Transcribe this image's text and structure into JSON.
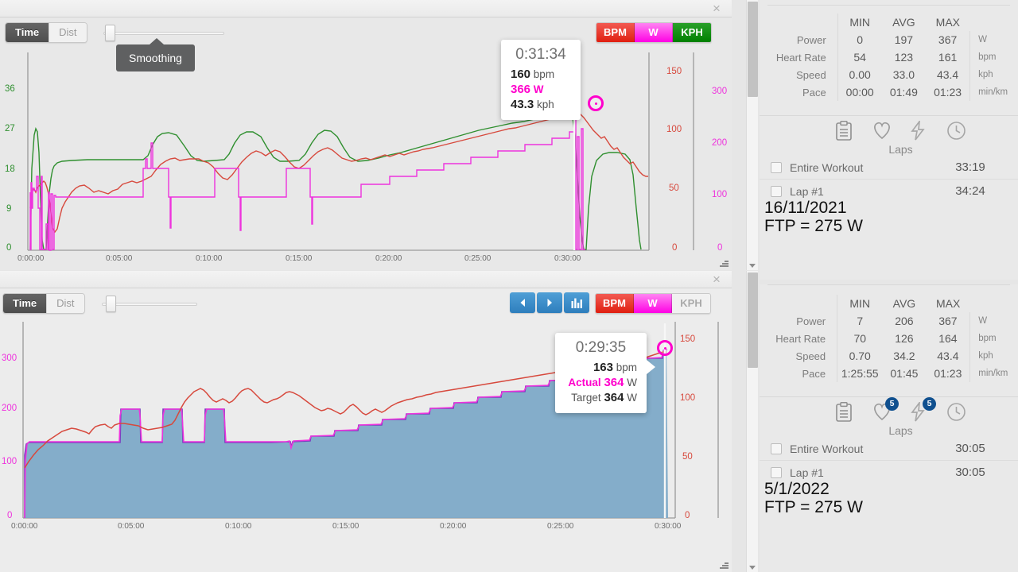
{
  "app": {
    "background": "#e6e6e6"
  },
  "colors": {
    "hr": "#d7493d",
    "power": "#ee33dd",
    "speed": "#2f8f2f",
    "target_fill": "#7ba7c7",
    "target_line": "#7b3fbf",
    "accent_blue": "#2e7ebd",
    "badge_blue": "#10508f",
    "marker": "#ff00cc"
  },
  "chart1": {
    "close_label": "×",
    "xaxis_toggle": {
      "options": [
        "Time",
        "Dist"
      ],
      "selected": "Time"
    },
    "smoothing": {
      "tooltip": "Smoothing",
      "value": 0
    },
    "metrics": [
      {
        "label": "BPM",
        "active": true
      },
      {
        "label": "W",
        "active": true
      },
      {
        "label": "KPH",
        "active": true
      }
    ],
    "tooltip": {
      "time": "0:31:34",
      "rows": [
        {
          "value": "160",
          "unit": "bpm",
          "color": "dark"
        },
        {
          "value": "366",
          "unit": "W",
          "color": "power"
        },
        {
          "value": "43.3",
          "unit": "kph",
          "color": "dark"
        }
      ]
    },
    "chart_data": {
      "type": "line",
      "title": "",
      "xlabel": "",
      "grid": false,
      "legend": "none",
      "x_ticks": [
        "0:00:00",
        "0:05:00",
        "0:10:00",
        "0:15:00",
        "0:20:00",
        "0:25:00",
        "0:30:00"
      ],
      "xlim": [
        0,
        2070
      ],
      "axes": [
        {
          "name": "Speed",
          "unit": "kph",
          "side": "left",
          "color": "#2f8f2f",
          "ticks": [
            0,
            9,
            18,
            27,
            36
          ],
          "ylim": [
            0,
            40
          ]
        },
        {
          "name": "Heart Rate",
          "unit": "bpm",
          "side": "right-inner",
          "color": "#d7493d",
          "ticks": [
            0,
            50,
            100,
            150
          ],
          "ylim": [
            0,
            170
          ]
        },
        {
          "name": "Power",
          "unit": "W",
          "side": "right-outer",
          "color": "#ee33dd",
          "ticks": [
            0,
            100,
            200,
            300
          ],
          "ylim": [
            0,
            380
          ]
        }
      ],
      "series": [
        {
          "name": "Speed",
          "unit": "kph",
          "color": "#2f8f2f",
          "axis": "Speed"
        },
        {
          "name": "Heart Rate",
          "unit": "bpm",
          "color": "#d7493d",
          "axis": "Heart Rate"
        },
        {
          "name": "Power",
          "unit": "W",
          "color": "#ee33dd",
          "axis": "Power"
        }
      ],
      "cursor": {
        "time": "0:31:34",
        "bpm": 160,
        "watts": 366,
        "kph": 43.3
      }
    }
  },
  "chart2": {
    "close_label": "×",
    "xaxis_toggle": {
      "options": [
        "Time",
        "Dist"
      ],
      "selected": "Time"
    },
    "smoothing": {
      "value": 0
    },
    "nav": [
      {
        "icon": "prev-icon"
      },
      {
        "icon": "next-icon"
      },
      {
        "icon": "bar-chart-icon"
      }
    ],
    "metrics": [
      {
        "label": "BPM",
        "active": true
      },
      {
        "label": "W",
        "active": true
      },
      {
        "label": "KPH",
        "active": false
      }
    ],
    "tooltip": {
      "time": "0:29:35",
      "rows": [
        {
          "label": "",
          "value": "163",
          "unit": "bpm"
        },
        {
          "label": "Actual",
          "value": "364",
          "unit": "W"
        },
        {
          "label": "Target",
          "value": "364",
          "unit": "W"
        }
      ]
    },
    "chart_data": {
      "type": "area",
      "title": "",
      "xlabel": "",
      "grid": false,
      "legend": "none",
      "x_ticks": [
        "0:00:00",
        "0:05:00",
        "0:10:00",
        "0:15:00",
        "0:20:00",
        "0:25:00",
        "0:30:00"
      ],
      "xlim": [
        0,
        1805
      ],
      "axes": [
        {
          "name": "Power",
          "unit": "W",
          "side": "left",
          "color": "#ee33dd",
          "ticks": [
            0,
            100,
            200,
            300
          ],
          "ylim": [
            0,
            380
          ]
        },
        {
          "name": "Heart Rate",
          "unit": "bpm",
          "side": "right",
          "color": "#d7493d",
          "ticks": [
            0,
            50,
            100,
            150
          ],
          "ylim": [
            0,
            175
          ]
        }
      ],
      "series": [
        {
          "name": "Target Power",
          "unit": "W",
          "color": "#7b3fbf",
          "fill": "#7ba7c7",
          "axis": "Power"
        },
        {
          "name": "Actual Power",
          "unit": "W",
          "color": "#ee33dd",
          "axis": "Power"
        },
        {
          "name": "Heart Rate",
          "unit": "bpm",
          "color": "#d7493d",
          "axis": "Heart Rate"
        }
      ],
      "cursor": {
        "time": "0:29:35",
        "bpm": 163,
        "actual_w": 364,
        "target_w": 364
      }
    }
  },
  "sidebar": {
    "panel1": {
      "stats": {
        "columns": [
          "",
          "MIN",
          "AVG",
          "MAX",
          ""
        ],
        "rows": [
          {
            "label": "Power",
            "min": "0",
            "avg": "197",
            "max": "367",
            "unit": "W"
          },
          {
            "label": "Heart Rate",
            "min": "54",
            "avg": "123",
            "max": "161",
            "unit": "bpm"
          },
          {
            "label": "Speed",
            "min": "0.00",
            "avg": "33.0",
            "max": "43.4",
            "unit": "kph"
          },
          {
            "label": "Pace",
            "min": "00:00",
            "avg": "01:49",
            "max": "01:23",
            "unit": "min/km"
          }
        ]
      },
      "tabs": [
        {
          "icon": "clipboard-icon",
          "badge": null
        },
        {
          "icon": "heart-icon",
          "badge": null
        },
        {
          "icon": "lightning-icon",
          "badge": null
        },
        {
          "icon": "clock-icon",
          "badge": null
        }
      ],
      "laps_label": "Laps",
      "laps": [
        {
          "name": "Entire Workout",
          "time": "33:19",
          "checked": false
        },
        {
          "name": "Lap #1",
          "time": "34:24",
          "checked": false
        }
      ],
      "overlay": {
        "date": "16/11/2021",
        "ftp": "FTP = 275 W"
      }
    },
    "panel2": {
      "stats": {
        "columns": [
          "",
          "MIN",
          "AVG",
          "MAX",
          ""
        ],
        "rows": [
          {
            "label": "Power",
            "min": "7",
            "avg": "206",
            "max": "367",
            "unit": "W"
          },
          {
            "label": "Heart Rate",
            "min": "70",
            "avg": "126",
            "max": "164",
            "unit": "bpm"
          },
          {
            "label": "Speed",
            "min": "0.70",
            "avg": "34.2",
            "max": "43.4",
            "unit": "kph"
          },
          {
            "label": "Pace",
            "min": "1:25:55",
            "avg": "01:45",
            "max": "01:23",
            "unit": "min/km"
          }
        ]
      },
      "tabs": [
        {
          "icon": "clipboard-icon",
          "badge": null
        },
        {
          "icon": "heart-icon",
          "badge": "5"
        },
        {
          "icon": "lightning-icon",
          "badge": "5"
        },
        {
          "icon": "clock-icon",
          "badge": null
        }
      ],
      "laps_label": "Laps",
      "laps": [
        {
          "name": "Entire Workout",
          "time": "30:05",
          "checked": false
        },
        {
          "name": "Lap #1",
          "time": "30:05",
          "checked": false
        }
      ],
      "overlay": {
        "date": "5/1/2022",
        "ftp": "FTP = 275 W"
      }
    }
  }
}
